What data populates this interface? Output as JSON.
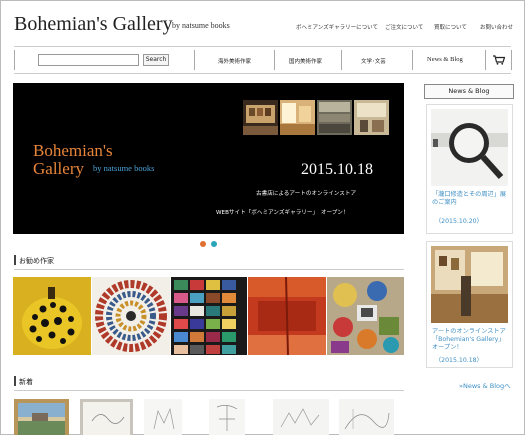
{
  "header": {
    "logo": "Bohemian's Gallery",
    "logo_sub": "by natsume books",
    "links": [
      "ボヘミアンズギャラリーについて",
      "ご注文について",
      "買取について",
      "お問い合わせ"
    ]
  },
  "search": {
    "value": "",
    "placeholder": "",
    "button": "Search"
  },
  "nav": {
    "items": [
      "海外美術作家",
      "国内美術作家",
      "文学･文芸",
      "News & Blog"
    ],
    "cart_icon": "cart-icon"
  },
  "hero": {
    "brand_line1": "Bohemian's",
    "brand_line2": "Gallery",
    "brand_by": "by natsume books",
    "date": "2015.10.18",
    "line1": "古書店によるアートのオンラインストア",
    "line2": "WEBサイト「ボヘミアンズギャラリー」　オープン！",
    "dot_colors": [
      "#e07030",
      "#2aa6b8"
    ]
  },
  "sections": {
    "recommended": "お勧め作家",
    "new_arrivals": "新着"
  },
  "sidebar": {
    "header": "News & Blog",
    "cards": [
      {
        "text": "「瀧口修造とその周辺」展のご案内",
        "date": "（2015.10.20）"
      },
      {
        "text": "アートのオンラインストア「Bohemian's Gallery」オープン！",
        "date": "（2015.10.18）"
      }
    ],
    "more": "»News & Blogへ"
  },
  "colors": {
    "accent_orange": "#e8853a",
    "accent_blue": "#3f8fc4"
  }
}
